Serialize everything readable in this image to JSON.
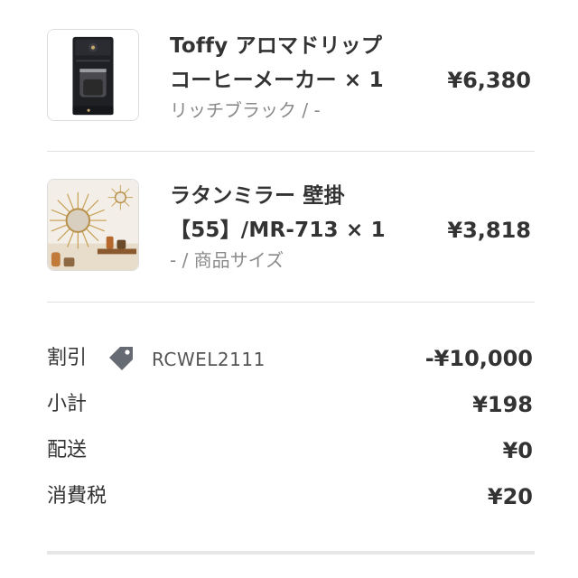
{
  "items": [
    {
      "name_line1": "Toffy アロマドリップ",
      "name_line2": "コーヒーメーカー × 1",
      "variant": "リッチブラック / -",
      "price": "¥6,380",
      "image": "coffee-maker-image"
    },
    {
      "name_line1": "ラタンミラー 壁掛",
      "name_line2": "【55】/MR-713 × 1",
      "variant": "- / 商品サイズ",
      "price": "¥3,818",
      "image": "rattan-mirror-image"
    }
  ],
  "summary": {
    "discount": {
      "label": "割引",
      "code": "RCWEL2111",
      "value": "-¥10,000",
      "icon": "tag-icon"
    },
    "subtotal": {
      "label": "小計",
      "value": "¥198"
    },
    "shipping": {
      "label": "配送",
      "value": "¥0"
    },
    "tax": {
      "label": "消費税",
      "value": "¥20"
    }
  },
  "colors": {
    "text": "#333333",
    "muted": "#8a8a8a",
    "divider": "#e0e0e0",
    "tag": "#666b73"
  }
}
